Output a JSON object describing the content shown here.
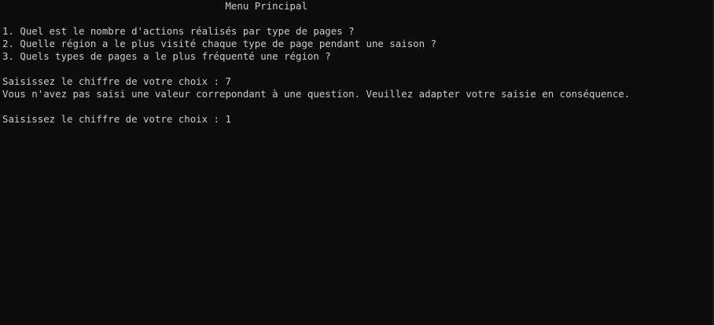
{
  "console": {
    "lines": [
      "                                      Menu Principal",
      "",
      "1. Quel est le nombre d'actions réalisés par type de pages ?",
      "2. Quelle région a le plus visité chaque type de page pendant une saison ?",
      "3. Quels types de pages a le plus fréquenté une région ?",
      "",
      "Saisissez le chiffre de votre choix : 7",
      "Vous n'avez pas saisi une valeur correpondant à une question. Veuillez adapter votre saisie en conséquence.",
      "",
      "Saisissez le chiffre de votre choix : 1"
    ]
  }
}
